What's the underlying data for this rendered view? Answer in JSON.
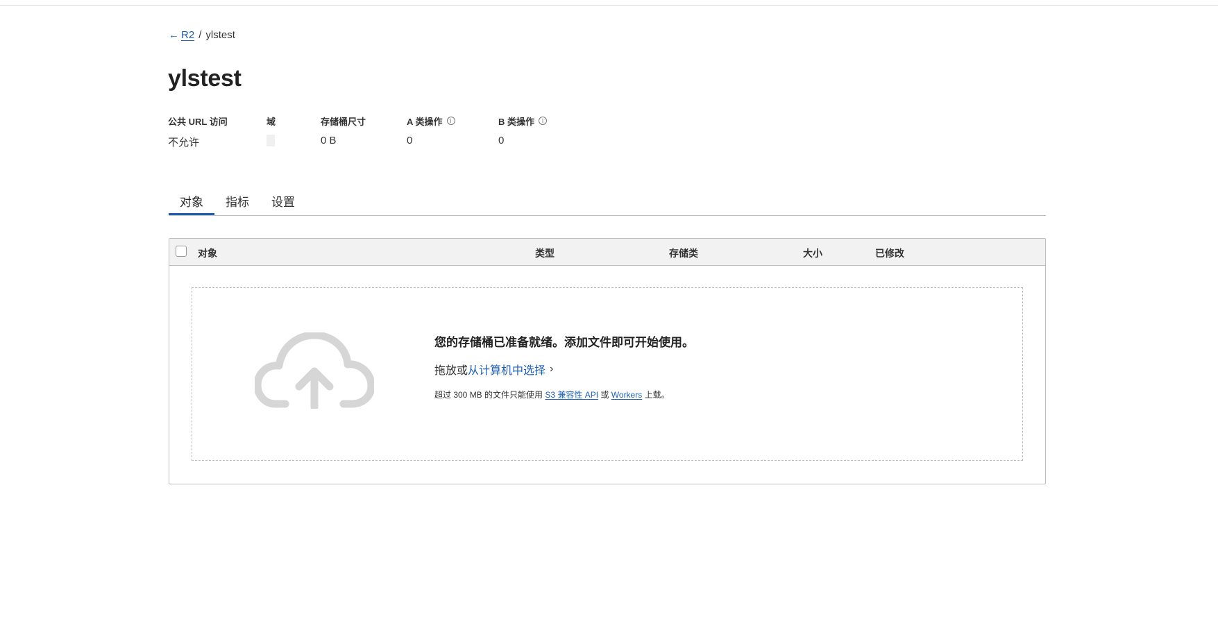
{
  "breadcrumb": {
    "back_label": "R2",
    "separator": "/",
    "current": "ylstest"
  },
  "page_title": "ylstest",
  "stats": {
    "public_url": {
      "label": "公共 URL 访问",
      "value": "不允许"
    },
    "domain": {
      "label": "域",
      "value": ""
    },
    "bucket_size": {
      "label": "存储桶尺寸",
      "value": "0 B"
    },
    "class_a": {
      "label": "A 类操作",
      "value": "0"
    },
    "class_b": {
      "label": "B 类操作",
      "value": "0"
    }
  },
  "tabs": [
    {
      "label": "对象",
      "active": true
    },
    {
      "label": "指标",
      "active": false
    },
    {
      "label": "设置",
      "active": false
    }
  ],
  "table": {
    "columns": [
      "对象",
      "类型",
      "存储类",
      "大小",
      "已修改"
    ]
  },
  "dropzone": {
    "title": "您的存储桶已准备就绪。添加文件即可开始使用。",
    "drag_prefix": "拖放或",
    "select_link": "从计算机中选择",
    "note_prefix": "超过 300 MB 的文件只能使用",
    "s3_link": "S3 兼容性 API",
    "note_or": "或",
    "workers_link": "Workers",
    "note_suffix": "上载。"
  },
  "colors": {
    "accent": "#1e5fb4",
    "header_bg": "#f2f2f2",
    "cloud": "#d6d6d6"
  },
  "icons": {
    "back": "arrow-left-icon",
    "info": "info-icon",
    "upload": "cloud-upload-icon",
    "chevron": "chevron-right-icon"
  }
}
